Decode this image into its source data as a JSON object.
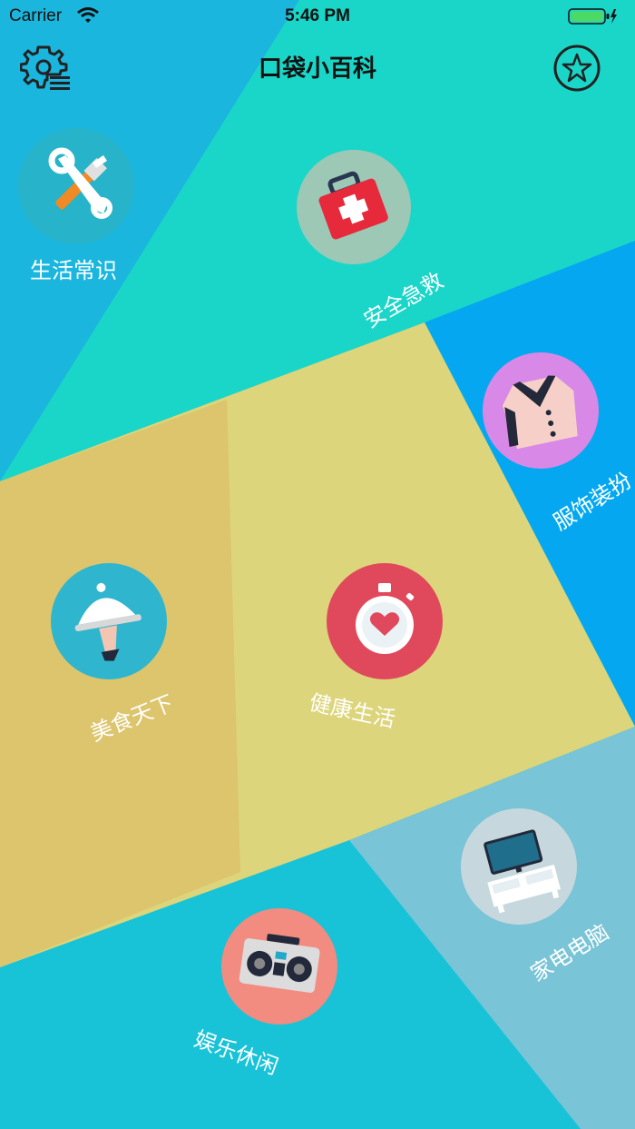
{
  "status_bar": {
    "carrier": "Carrier",
    "time": "5:46 PM"
  },
  "header": {
    "title": "口袋小百科"
  },
  "icons": {
    "settings": "gear-list-icon",
    "favorite": "star-icon"
  },
  "categories": [
    {
      "id": "life",
      "label": "生活常识",
      "icon": "tools-icon",
      "circle_color": "#27b3c9"
    },
    {
      "id": "safety",
      "label": "安全急救",
      "icon": "first-aid-kit-icon",
      "circle_color": "#9dc8b6"
    },
    {
      "id": "fashion",
      "label": "服饰装扮",
      "icon": "jacket-icon",
      "circle_color": "#d888e6"
    },
    {
      "id": "food",
      "label": "美食天下",
      "icon": "food-cloche-icon",
      "circle_color": "#2fb5cd"
    },
    {
      "id": "health",
      "label": "健康生活",
      "icon": "heart-stopwatch-icon",
      "circle_color": "#e0495c"
    },
    {
      "id": "appliance",
      "label": "家电电脑",
      "icon": "tv-cabinet-icon",
      "circle_color": "#c6d8dd"
    },
    {
      "id": "leisure",
      "label": "娱乐休闲",
      "icon": "boombox-icon",
      "circle_color": "#f28b80"
    }
  ]
}
